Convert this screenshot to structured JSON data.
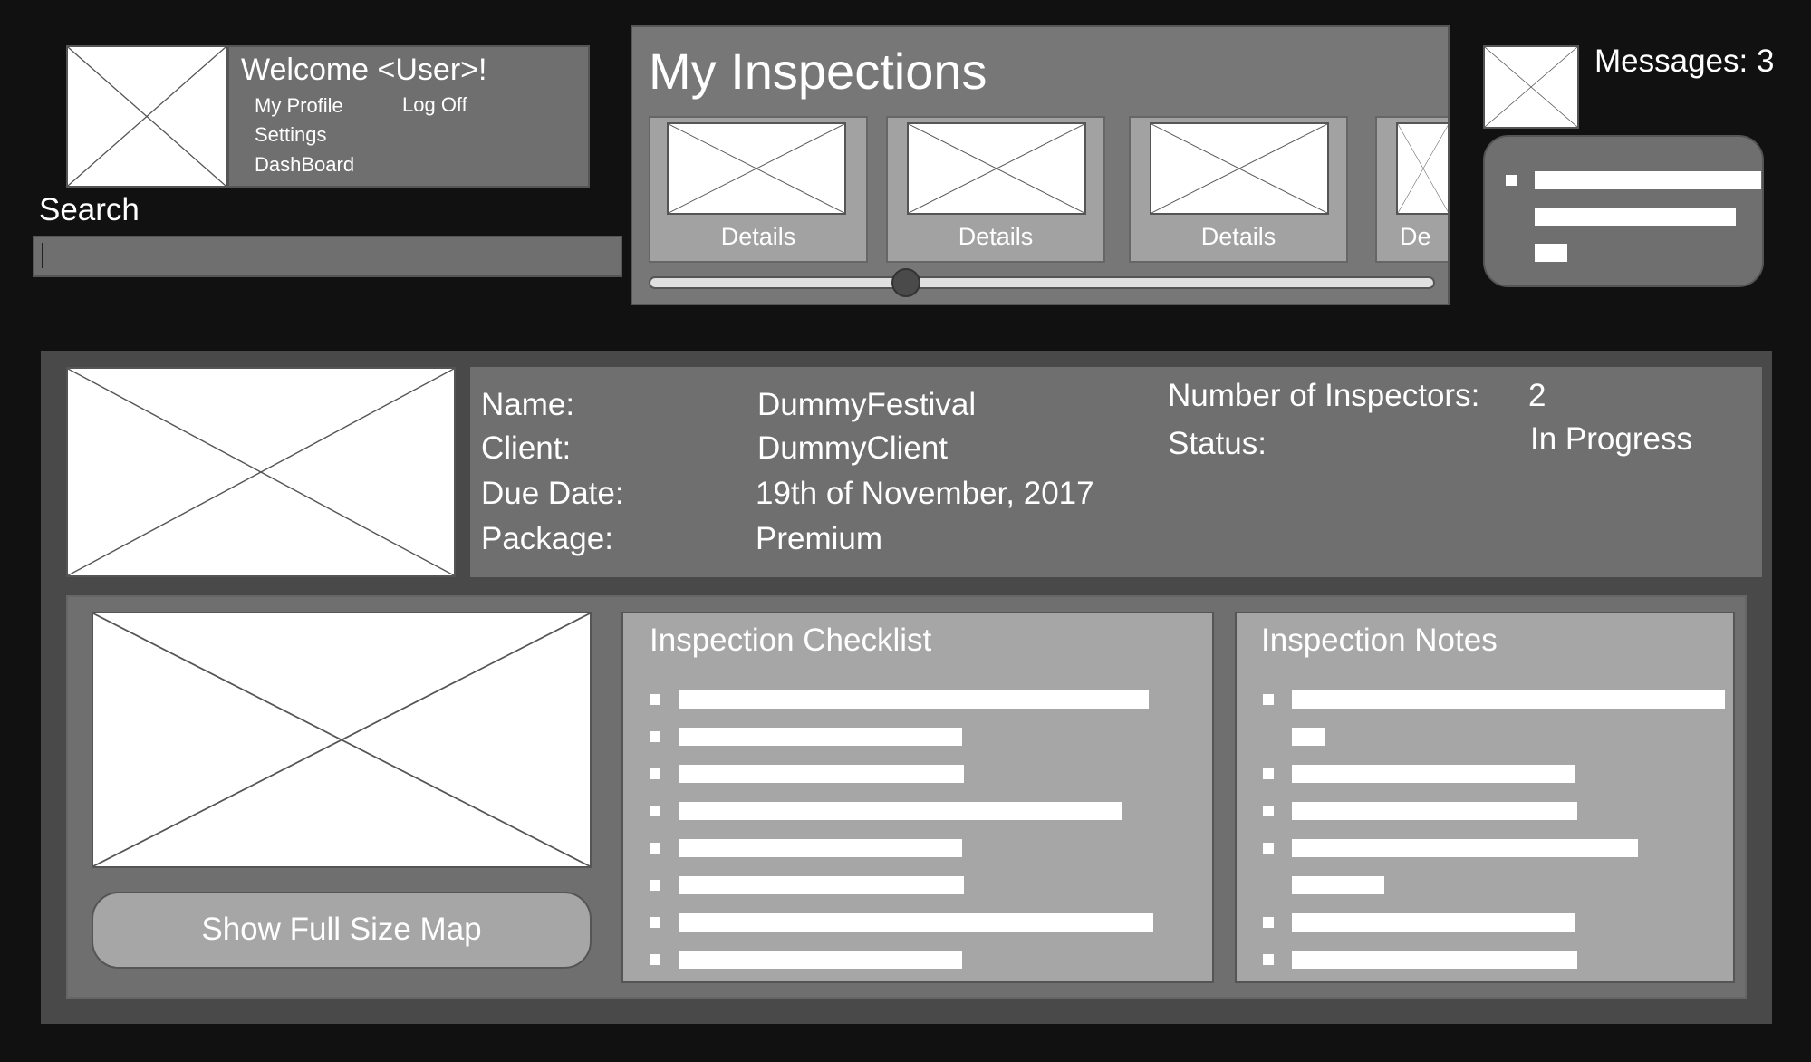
{
  "header": {
    "welcome": "Welcome <User>!",
    "menu": {
      "my_profile": "My Profile",
      "log_off": "Log Off",
      "settings": "Settings",
      "dashboard": "DashBoard"
    },
    "search_label": "Search",
    "search_value": ""
  },
  "inspections": {
    "title": "My Inspections",
    "cards": [
      {
        "label": "Details"
      },
      {
        "label": "Details"
      },
      {
        "label": "Details"
      },
      {
        "label": "De"
      }
    ],
    "slider_position": 0.32
  },
  "messages": {
    "label": "Messages: 3",
    "count": 3
  },
  "details": {
    "name_label": "Name:",
    "name_value": "DummyFestival",
    "client_label": "Client:",
    "client_value": "DummyClient",
    "due_label": "Due Date:",
    "due_value": "19th of November, 2017",
    "package_label": "Package:",
    "package_value": "Premium",
    "inspectors_label": "Number of Inspectors:",
    "inspectors_value": "2",
    "status_label": "Status:",
    "status_value": "In Progress"
  },
  "map": {
    "button_label": "Show Full Size Map"
  },
  "checklist": {
    "title": "Inspection Checklist"
  },
  "notes": {
    "title": "Inspection Notes"
  }
}
